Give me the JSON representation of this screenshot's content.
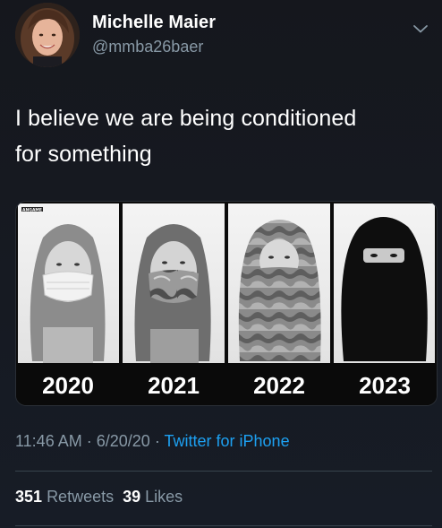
{
  "tweet": {
    "author": {
      "display_name": "Michelle Maier",
      "handle": "@mmba26baer"
    },
    "menu_icon": "chevron-down-icon",
    "text_line1": "I believe we are being conditioned",
    "text_line2": "for something",
    "media": {
      "panels": [
        {
          "year": "2020"
        },
        {
          "year": "2021"
        },
        {
          "year": "2022"
        },
        {
          "year": "2023"
        }
      ],
      "brand_mark": "ANGAME"
    },
    "time": "11:46 AM",
    "separator": "·",
    "date": "6/20/20",
    "source": "Twitter for iPhone",
    "retweets_count": "351",
    "retweets_label": "Retweets",
    "likes_count": "39",
    "likes_label": "Likes"
  },
  "colors": {
    "background": "#15202b",
    "text": "#ffffff",
    "muted": "#8899a6",
    "link": "#1da1f2",
    "divider": "#38444d"
  }
}
